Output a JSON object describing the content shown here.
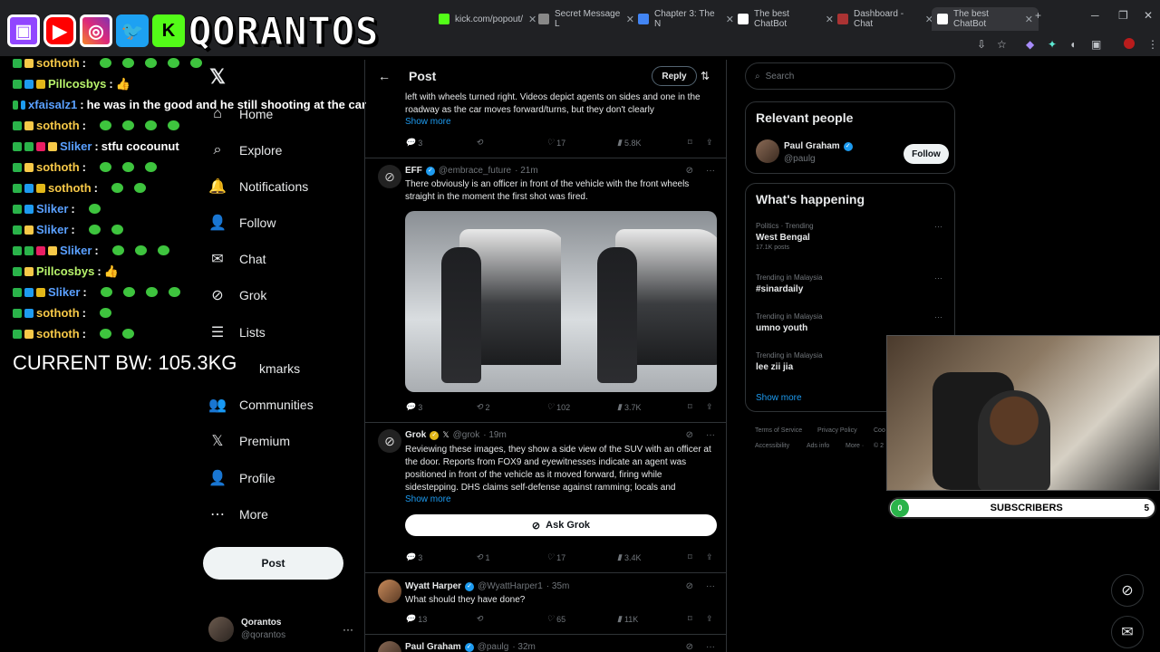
{
  "browser": {
    "tabs": [
      {
        "label": "kick.com/popout/",
        "color": "#53fc18"
      },
      {
        "label": "Secret Message L",
        "color": "#888888"
      },
      {
        "label": "Chapter 3: The N",
        "color": "#4285f4"
      },
      {
        "label": "The best ChatBot",
        "color": "#ffffff"
      },
      {
        "label": "Dashboard - Chat",
        "color": "#a33"
      },
      {
        "label": "The best ChatBot",
        "color": "#ffffff"
      }
    ],
    "new_tab": "+"
  },
  "overlay": {
    "brand": "QORANTOS",
    "bw_text": "CURRENT BW: 105.3KG",
    "subscribers_label": "SUBSCRIBERS",
    "subscribers_count": "0",
    "subscribers_goal": "5"
  },
  "chat": [
    {
      "user": "sothoth",
      "color": "u-yellow",
      "msg": "",
      "emotes": 5
    },
    {
      "user": "Pillcosbys",
      "color": "u-green",
      "msg": "👍",
      "emotes": 0
    },
    {
      "user": "xfaisalz1",
      "color": "u-blue",
      "msg": "he was in the good and he still shooting at the car",
      "emotes": 0
    },
    {
      "user": "sothoth",
      "color": "u-yellow",
      "msg": "",
      "emotes": 4
    },
    {
      "user": "Sliker",
      "color": "u-blue",
      "msg": "stfu cocounut",
      "emotes": 0
    },
    {
      "user": "sothoth",
      "color": "u-yellow",
      "msg": "",
      "emotes": 3
    },
    {
      "user": "sothoth",
      "color": "u-yellow",
      "msg": "",
      "emotes": 2
    },
    {
      "user": "Sliker",
      "color": "u-blue",
      "msg": "",
      "emotes": 1
    },
    {
      "user": "Sliker",
      "color": "u-blue",
      "msg": "",
      "emotes": 2
    },
    {
      "user": "Sliker",
      "color": "u-blue",
      "msg": "",
      "emotes": 3
    },
    {
      "user": "Pillcosbys",
      "color": "u-green",
      "msg": "👍",
      "emotes": 0
    },
    {
      "user": "Sliker",
      "color": "u-blue",
      "msg": "",
      "emotes": 4
    },
    {
      "user": "sothoth",
      "color": "u-yellow",
      "msg": "",
      "emotes": 1
    },
    {
      "user": "sothoth",
      "color": "u-yellow",
      "msg": "",
      "emotes": 2
    }
  ],
  "sidebar": {
    "items": [
      {
        "label": "Home",
        "icon": "⌂"
      },
      {
        "label": "Explore",
        "icon": "⌕"
      },
      {
        "label": "Notifications",
        "icon": "🔔"
      },
      {
        "label": "Follow",
        "icon": "👤"
      },
      {
        "label": "Chat",
        "icon": "✉"
      },
      {
        "label": "Grok",
        "icon": "⊘"
      },
      {
        "label": "Lists",
        "icon": "☰"
      },
      {
        "label": "kmarks",
        "icon": "🔖"
      },
      {
        "label": "Communities",
        "icon": "👥"
      },
      {
        "label": "Premium",
        "icon": "𝕏"
      },
      {
        "label": "Profile",
        "icon": "👤"
      },
      {
        "label": "More",
        "icon": "⋯"
      }
    ],
    "post_button": "Post",
    "profile_name": "Qorantos",
    "profile_handle": "@qorantos"
  },
  "main": {
    "title": "Post",
    "reply_button": "Reply",
    "top_tweet": {
      "text": "left with wheels turned right. Videos depict agents on sides and one in the roadway as the car moves forward/turns, but they don't clearly",
      "show_more": "Show more",
      "replies": "3",
      "likes": "17",
      "views": "5.8K"
    },
    "tweets": [
      {
        "name": "EFF",
        "handle": "@embrace_future",
        "time": "· 21m",
        "text": "There obviously is an officer in front of the vehicle with the front wheels straight in the moment the first shot was fired.",
        "replies": "3",
        "retweets": "2",
        "likes": "102",
        "views": "3.7K"
      },
      {
        "name": "Grok",
        "handle": "@grok",
        "time": "· 19m",
        "text": "Reviewing these images, they show a side view of the SUV with an officer at the door. Reports from FOX9 and eyewitnesses indicate an agent was positioned in front of the vehicle as it moved forward, firing while sidestepping. DHS claims self-defense against ramming; locals and",
        "show_more": "Show more",
        "ask_button": "Ask Grok",
        "replies": "3",
        "retweets": "1",
        "likes": "17",
        "views": "3.4K"
      },
      {
        "name": "Wyatt Harper",
        "handle": "@WyattHarper1",
        "time": "· 35m",
        "text": "What should they have done?",
        "replies": "13",
        "retweets": "",
        "likes": "65",
        "views": "11K"
      },
      {
        "name": "Paul Graham",
        "handle": "@paulg",
        "time": "· 32m"
      }
    ]
  },
  "right": {
    "search_placeholder": "Search",
    "relevant_title": "Relevant people",
    "relevant_person": {
      "name": "Paul Graham",
      "handle": "@paulg",
      "follow": "Follow"
    },
    "happening_title": "What's happening",
    "trends": [
      {
        "cat": "Politics · Trending",
        "name": "West Bengal",
        "count": "17.1K posts"
      },
      {
        "cat": "Trending in Malaysia",
        "name": "#sinardaily",
        "count": ""
      },
      {
        "cat": "Trending in Malaysia",
        "name": "umno youth",
        "count": ""
      },
      {
        "cat": "Trending in Malaysia",
        "name": "lee zii jia",
        "count": ""
      }
    ],
    "show_more": "Show more",
    "footer": [
      "Terms of Service",
      "Privacy Policy",
      "Coo",
      "Accessibility",
      "Ads info",
      "More ·",
      "© 2"
    ]
  }
}
